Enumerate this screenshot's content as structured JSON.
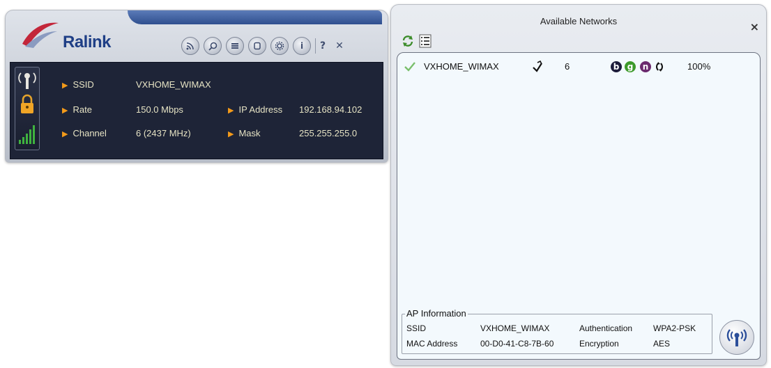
{
  "ralink": {
    "brand": "Ralink",
    "toolbar": {
      "help": "?",
      "close": "✕"
    },
    "ssid_label": "SSID",
    "ssid_value": "VXHOME_WIMAX",
    "rate_label": "Rate",
    "rate_value": "150.0 Mbps",
    "ip_label": "IP Address",
    "ip_value": "192.168.94.102",
    "channel_label": "Channel",
    "channel_value": "6 (2437 MHz)",
    "mask_label": "Mask",
    "mask_value": "255.255.255.0",
    "colors": {
      "panel": "#1e2437",
      "text": "#e6e3c4",
      "arrow": "#f39a1a",
      "signal": "#3fb33f"
    }
  },
  "networks": {
    "title": "Available Networks",
    "close": "×",
    "list": [
      {
        "ssid": "VXHOME_WIMAX",
        "channel": "6",
        "modes": [
          "b",
          "g",
          "n"
        ],
        "signal": "100%",
        "icons": [
          "checkmark-icon",
          "secured-network-icon",
          "wifi-mode-b-icon",
          "wifi-mode-g-icon",
          "wifi-mode-n-icon",
          "wps-arrows-icon"
        ]
      }
    ],
    "ap_info": {
      "legend": "AP Information",
      "ssid_label": "SSID",
      "ssid_value": "VXHOME_WIMAX",
      "auth_label": "Authentication",
      "auth_value": "WPA2-PSK",
      "mac_label": "MAC Address",
      "mac_value": "00-D0-41-C8-7B-60",
      "enc_label": "Encryption",
      "enc_value": "AES"
    },
    "colors": {
      "list_bg": "#f3f9fd",
      "badge_b": "#1c1c3a",
      "badge_g": "#3d9a2b",
      "badge_n": "#6b2a6e"
    }
  }
}
